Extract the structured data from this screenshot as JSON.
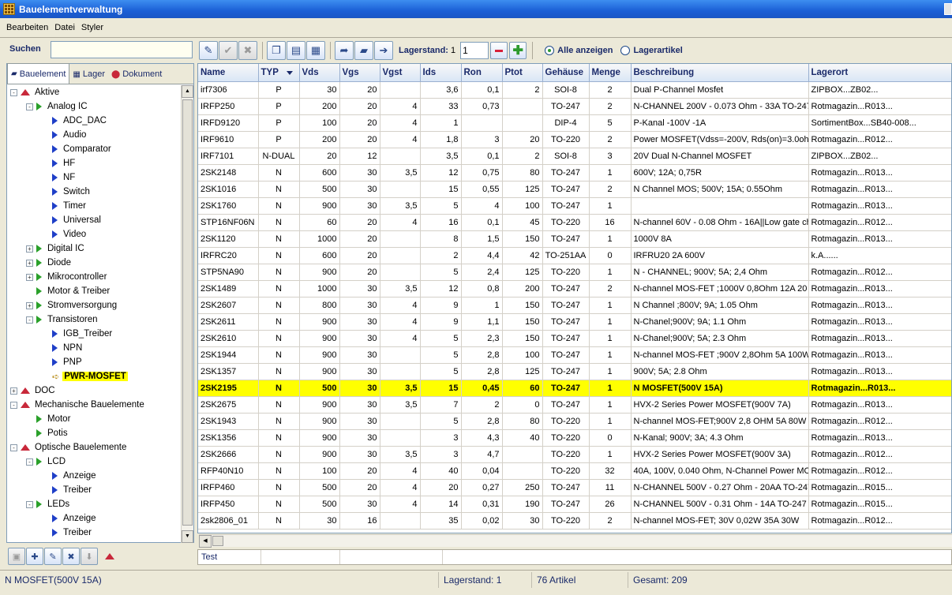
{
  "window": {
    "title": "Bauelementverwaltung"
  },
  "menu": [
    "Bearbeiten",
    "Datei",
    "Styler"
  ],
  "search": {
    "label": "Suchen",
    "value": ""
  },
  "toolbar": {
    "lagerstand_label": "Lagerstand:",
    "lagerstand_value": "1",
    "lagerstand_input": "1",
    "radio_all": "Alle anzeigen",
    "radio_stock": "Lagerartikel"
  },
  "tabs": [
    {
      "label": "Bauelement",
      "icon": "chip-icon"
    },
    {
      "label": "Lager",
      "icon": "grid-icon"
    },
    {
      "label": "Dokument",
      "icon": "pdf-icon"
    }
  ],
  "tree": [
    {
      "label": "Aktive",
      "level": 0,
      "icon": "red",
      "exp": "-"
    },
    {
      "label": "Analog IC",
      "level": 1,
      "icon": "green",
      "exp": "-"
    },
    {
      "label": "ADC_DAC",
      "level": 2,
      "icon": "blue"
    },
    {
      "label": "Audio",
      "level": 2,
      "icon": "blue"
    },
    {
      "label": "Comparator",
      "level": 2,
      "icon": "blue"
    },
    {
      "label": "HF",
      "level": 2,
      "icon": "blue"
    },
    {
      "label": "NF",
      "level": 2,
      "icon": "blue"
    },
    {
      "label": "Switch",
      "level": 2,
      "icon": "blue"
    },
    {
      "label": "Timer",
      "level": 2,
      "icon": "blue"
    },
    {
      "label": "Universal",
      "level": 2,
      "icon": "blue"
    },
    {
      "label": "Video",
      "level": 2,
      "icon": "blue"
    },
    {
      "label": "Digital IC",
      "level": 1,
      "icon": "green",
      "exp": "+"
    },
    {
      "label": "Diode",
      "level": 1,
      "icon": "green",
      "exp": "+"
    },
    {
      "label": "Mikrocontroller",
      "level": 1,
      "icon": "green",
      "exp": "+"
    },
    {
      "label": "Motor & Treiber",
      "level": 1,
      "icon": "green"
    },
    {
      "label": "Stromversorgung",
      "level": 1,
      "icon": "green",
      "exp": "+"
    },
    {
      "label": "Transistoren",
      "level": 1,
      "icon": "green",
      "exp": "-"
    },
    {
      "label": "IGB_Treiber",
      "level": 2,
      "icon": "blue"
    },
    {
      "label": "NPN",
      "level": 2,
      "icon": "blue"
    },
    {
      "label": "PNP",
      "level": 2,
      "icon": "blue"
    },
    {
      "label": "PWR-MOSFET",
      "level": 2,
      "icon": "arrow",
      "selected": true
    },
    {
      "label": "DOC",
      "level": 0,
      "icon": "red",
      "exp": "+"
    },
    {
      "label": "Mechanische Bauelemente",
      "level": 0,
      "icon": "red",
      "exp": "-"
    },
    {
      "label": "Motor",
      "level": 1,
      "icon": "green"
    },
    {
      "label": "Potis",
      "level": 1,
      "icon": "green"
    },
    {
      "label": "Optische Bauelemente",
      "level": 0,
      "icon": "red",
      "exp": "-"
    },
    {
      "label": "LCD",
      "level": 1,
      "icon": "green",
      "exp": "-"
    },
    {
      "label": "Anzeige",
      "level": 2,
      "icon": "blue"
    },
    {
      "label": "Treiber",
      "level": 2,
      "icon": "blue"
    },
    {
      "label": "LEDs",
      "level": 1,
      "icon": "green",
      "exp": "-"
    },
    {
      "label": "Anzeige",
      "level": 2,
      "icon": "blue"
    },
    {
      "label": "Treiber",
      "level": 2,
      "icon": "blue"
    }
  ],
  "table": {
    "columns": [
      "Name",
      "TYP",
      "Vds",
      "Vgs",
      "Vgst",
      "Ids",
      "Ron",
      "Ptot",
      "Gehäuse",
      "Menge",
      "Beschreibung",
      "Lagerort"
    ],
    "selected_index": 18,
    "rows": [
      [
        "irf7306",
        "P",
        "30",
        "20",
        "",
        "3,6",
        "0,1",
        "2",
        "SOI-8",
        "2",
        "Dual P-Channel Mosfet",
        "ZIPBOX...ZB02..."
      ],
      [
        "IRFP250",
        "P",
        "200",
        "20",
        "4",
        "33",
        "0,73",
        "",
        "TO-247",
        "2",
        "N-CHANNEL 200V - 0.073 Ohm - 33A TO-247",
        "Rotmagazin...R013..."
      ],
      [
        "IRFD9120",
        "P",
        "100",
        "20",
        "4",
        "1",
        "",
        "",
        "DIP-4",
        "5",
        "P-Kanal -100V -1A",
        "SortimentBox...SB40-008..."
      ],
      [
        "IRF9610",
        "P",
        "200",
        "20",
        "4",
        "1,8",
        "3",
        "20",
        "TO-220",
        "2",
        "Power MOSFET(Vdss=-200V, Rds(on)=3.0ohm",
        "Rotmagazin...R012..."
      ],
      [
        "IRF7101",
        "N-DUAL",
        "20",
        "12",
        "",
        "3,5",
        "0,1",
        "2",
        "SOI-8",
        "3",
        "20V Dual N-Channel MOSFET",
        "ZIPBOX...ZB02..."
      ],
      [
        "2SK2148",
        "N",
        "600",
        "30",
        "3,5",
        "12",
        "0,75",
        "80",
        "TO-247",
        "1",
        "600V; 12A; 0,75R",
        "Rotmagazin...R013..."
      ],
      [
        "2SK1016",
        "N",
        "500",
        "30",
        "",
        "15",
        "0,55",
        "125",
        "TO-247",
        "2",
        "N Channel MOS; 500V; 15A; 0.55Ohm",
        "Rotmagazin...R013..."
      ],
      [
        "2SK1760",
        "N",
        "900",
        "30",
        "3,5",
        "5",
        "4",
        "100",
        "TO-247",
        "1",
        "",
        "Rotmagazin...R013..."
      ],
      [
        "STP16NF06N",
        "N",
        "60",
        "20",
        "4",
        "16",
        "0,1",
        "45",
        "TO-220",
        "16",
        "N-channel 60V - 0.08 Ohm - 16A||Low gate ch",
        "Rotmagazin...R012..."
      ],
      [
        "2SK1120",
        "N",
        "1000",
        "20",
        "",
        "8",
        "1,5",
        "150",
        "TO-247",
        "1",
        "1000V 8A",
        "Rotmagazin...R013..."
      ],
      [
        "IRFRC20",
        "N",
        "600",
        "20",
        "",
        "2",
        "4,4",
        "42",
        "TO-251AA",
        "0",
        "IRFRU20 2A 600V",
        "k.A......"
      ],
      [
        "STP5NA90",
        "N",
        "900",
        "20",
        "",
        "5",
        "2,4",
        "125",
        "TO-220",
        "1",
        "N - CHANNEL; 900V; 5A; 2,4 Ohm",
        "Rotmagazin...R012..."
      ],
      [
        "2SK1489",
        "N",
        "1000",
        "30",
        "3,5",
        "12",
        "0,8",
        "200",
        "TO-247",
        "2",
        "N-channel MOS-FET ;1000V 0,8Ohm  12A  20",
        "Rotmagazin...R013..."
      ],
      [
        "2SK2607",
        "N",
        "800",
        "30",
        "4",
        "9",
        "1",
        "150",
        "TO-247",
        "1",
        "N Channel ;800V; 9A; 1.05 Ohm",
        "Rotmagazin...R013..."
      ],
      [
        "2SK2611",
        "N",
        "900",
        "30",
        "4",
        "9",
        "1,1",
        "150",
        "TO-247",
        "1",
        "N-Chanel;900V; 9A; 1.1 Ohm",
        "Rotmagazin...R013..."
      ],
      [
        "2SK2610",
        "N",
        "900",
        "30",
        "4",
        "5",
        "2,3",
        "150",
        "TO-247",
        "1",
        "N-Chanel;900V; 5A; 2.3 Ohm",
        "Rotmagazin...R013..."
      ],
      [
        "2SK1944",
        "N",
        "900",
        "30",
        "",
        "5",
        "2,8",
        "100",
        "TO-247",
        "1",
        "N-channel MOS-FET ;900V 2,8Ohm  5A 100W",
        "Rotmagazin...R013..."
      ],
      [
        "2SK1357",
        "N",
        "900",
        "30",
        "",
        "5",
        "2,8",
        "125",
        "TO-247",
        "1",
        "900V; 5A; 2.8 Ohm",
        "Rotmagazin...R013..."
      ],
      [
        "2SK2195",
        "N",
        "500",
        "30",
        "3,5",
        "15",
        "0,45",
        "60",
        "TO-247",
        "1",
        "N MOSFET(500V 15A)",
        "Rotmagazin...R013..."
      ],
      [
        "2SK2675",
        "N",
        "900",
        "30",
        "3,5",
        "7",
        "2",
        "0",
        "TO-247",
        "1",
        "HVX-2 Series Power MOSFET(900V 7A)",
        "Rotmagazin...R013..."
      ],
      [
        "2SK1943",
        "N",
        "900",
        "30",
        "",
        "5",
        "2,8",
        "80",
        "TO-220",
        "1",
        "N-channel MOS-FET;900V 2,8 OHM  5A 80W",
        "Rotmagazin...R012..."
      ],
      [
        "2SK1356",
        "N",
        "900",
        "30",
        "",
        "3",
        "4,3",
        "40",
        "TO-220",
        "0",
        "N-Kanal; 900V; 3A; 4.3 Ohm",
        "Rotmagazin...R013..."
      ],
      [
        "2SK2666",
        "N",
        "900",
        "30",
        "3,5",
        "3",
        "4,7",
        "",
        "TO-220",
        "1",
        "HVX-2 Series Power MOSFET(900V 3A)",
        "Rotmagazin...R012..."
      ],
      [
        "RFP40N10",
        "N",
        "100",
        "20",
        "4",
        "40",
        "0,04",
        "",
        "TO-220",
        "32",
        "40A, 100V, 0.040 Ohm, N-Channel Power MOS",
        "Rotmagazin...R012..."
      ],
      [
        "IRFP460",
        "N",
        "500",
        "20",
        "4",
        "20",
        "0,27",
        "250",
        "TO-247",
        "11",
        "N-CHANNEL 500V - 0.27 Ohm - 20AA TO-247",
        "Rotmagazin...R015..."
      ],
      [
        "IRFP450",
        "N",
        "500",
        "30",
        "4",
        "14",
        "0,31",
        "190",
        "TO-247",
        "26",
        "N-CHANNEL 500V - 0.31 Ohm - 14A TO-247",
        "Rotmagazin...R015..."
      ],
      [
        "2sk2806_01",
        "N",
        "30",
        "16",
        "",
        "35",
        "0,02",
        "30",
        "TO-220",
        "2",
        "N-channel MOS-FET; 30V 0,02W  35A 30W",
        "Rotmagazin...R012..."
      ]
    ]
  },
  "footer_row": {
    "cell0": "Test"
  },
  "status": {
    "selected": "N MOSFET(500V 15A)",
    "lagerstand": "Lagerstand: 1",
    "artikel": "76 Artikel",
    "gesamt": "Gesamt: 209"
  }
}
